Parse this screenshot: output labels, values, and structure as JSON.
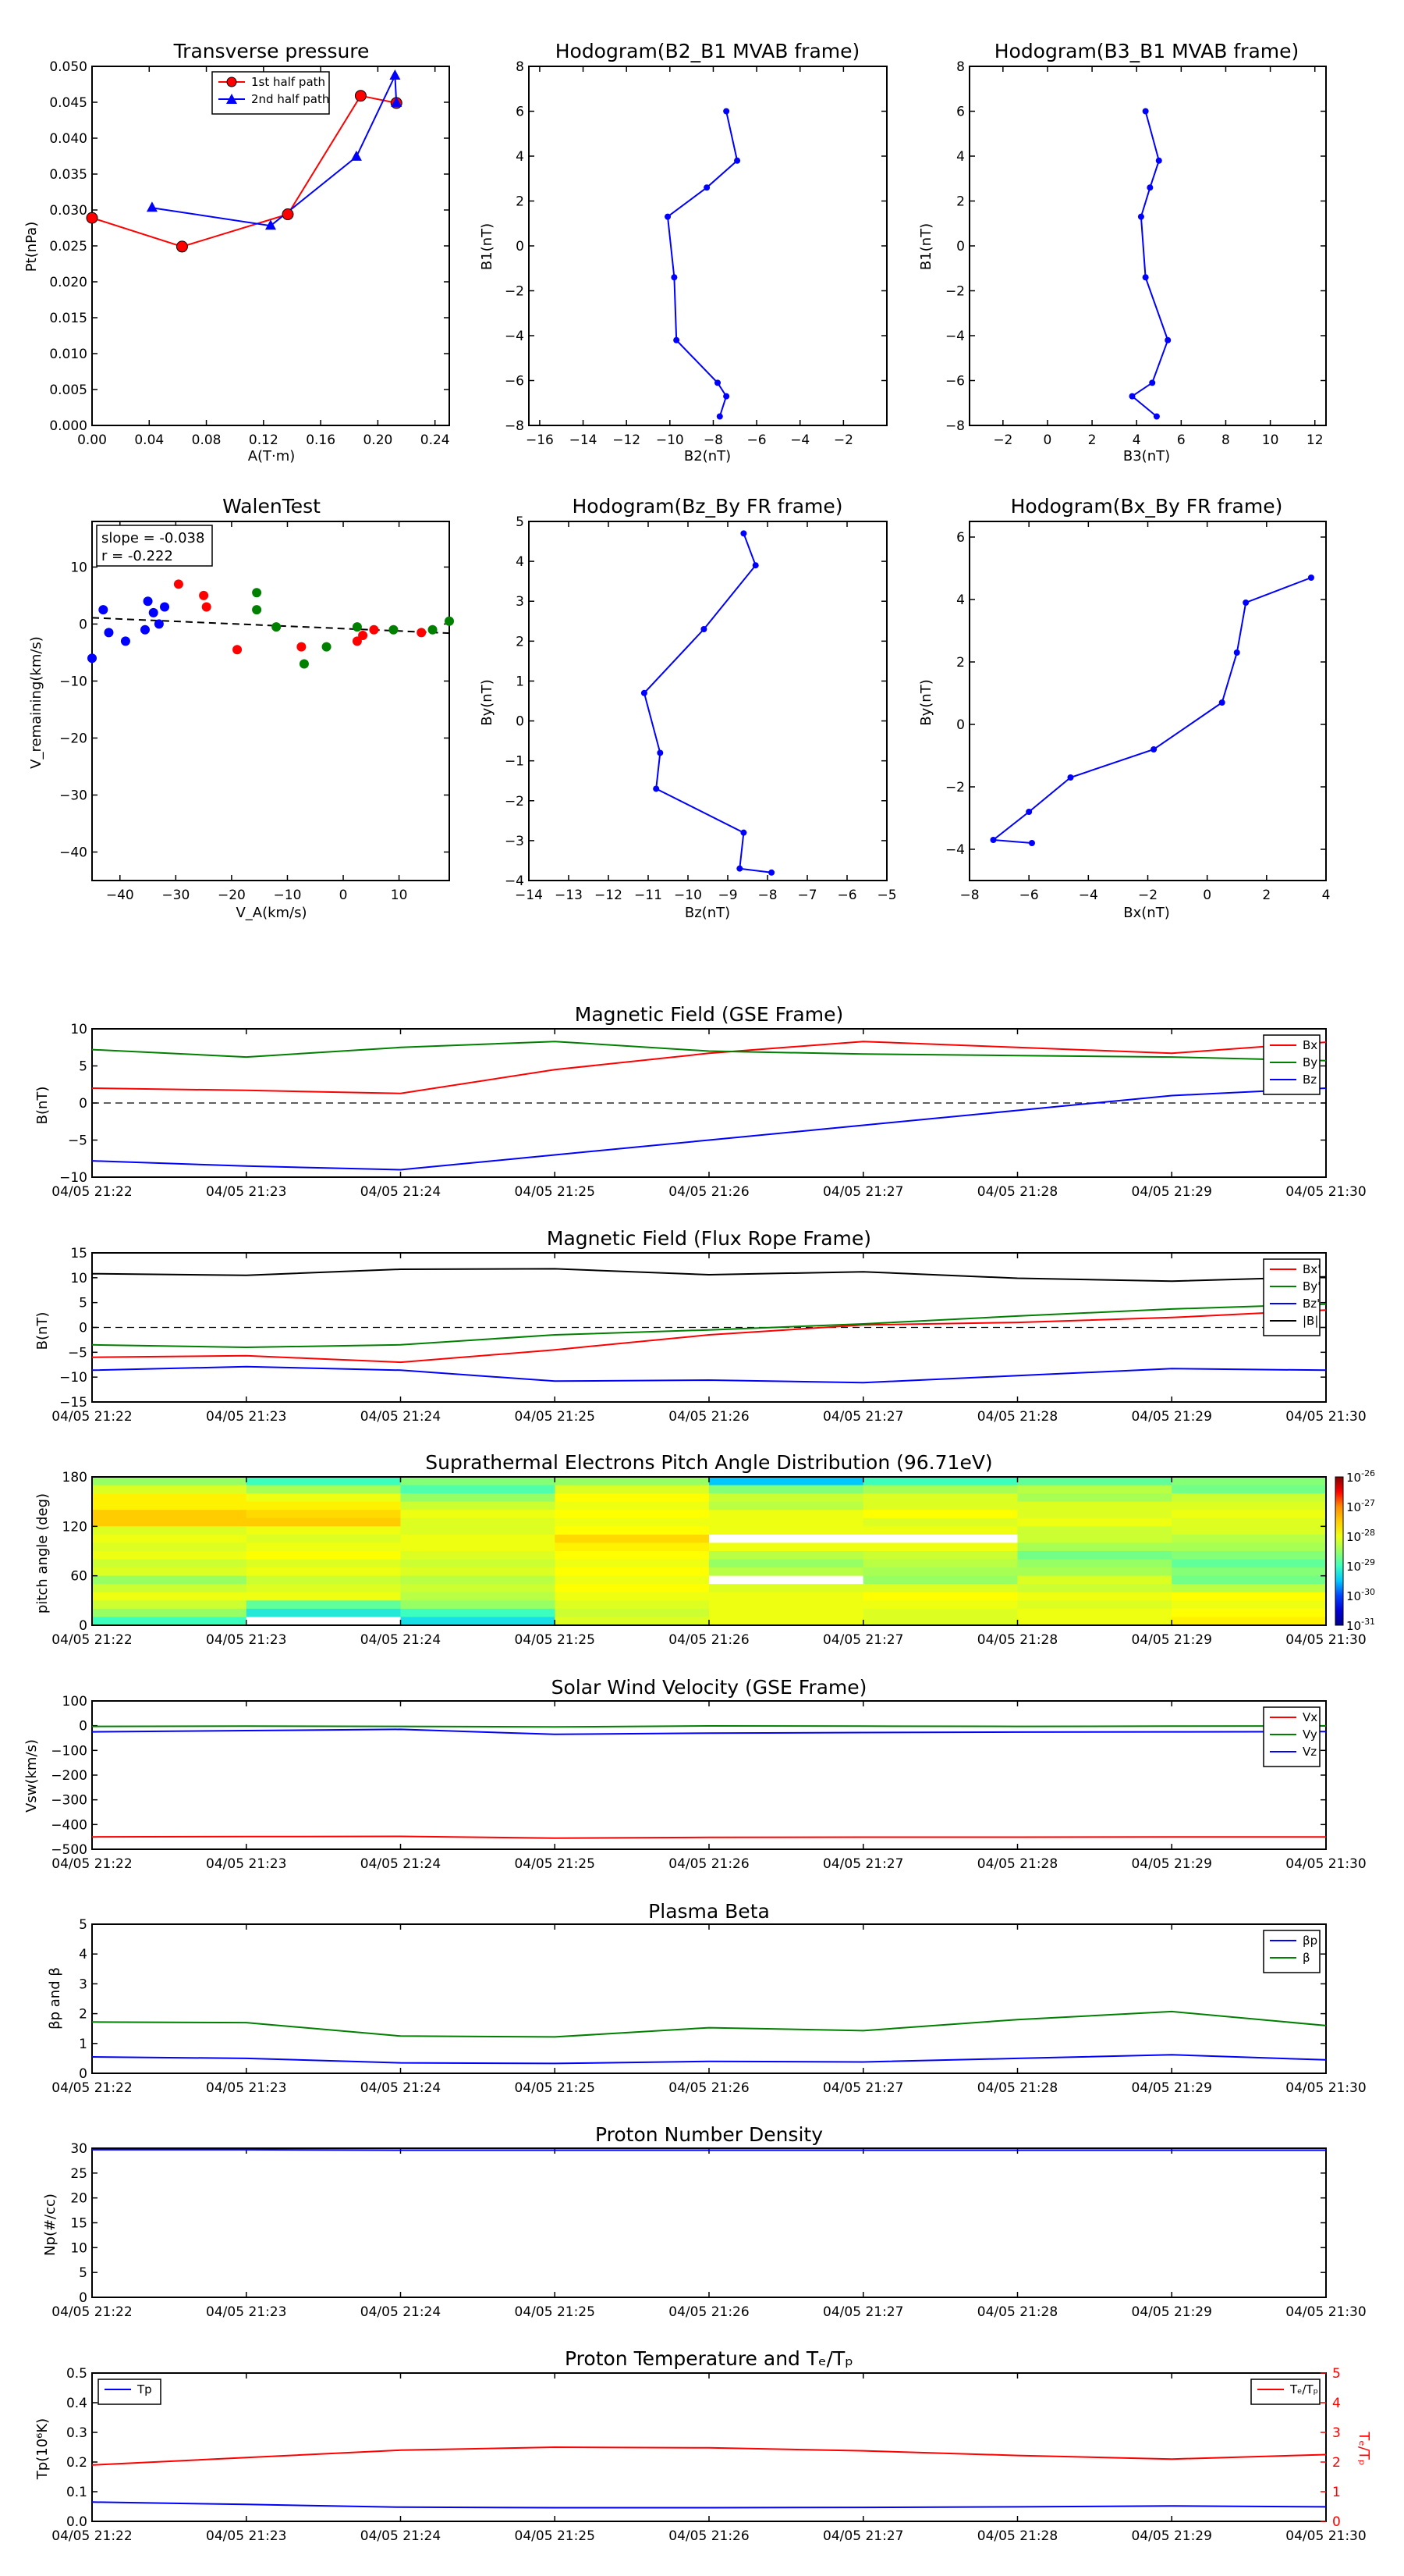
{
  "time_ticks": [
    "04/05 21:22",
    "04/05 21:23",
    "04/05 21:24",
    "04/05 21:25",
    "04/05 21:26",
    "04/05 21:27",
    "04/05 21:28",
    "04/05 21:29",
    "04/05 21:30"
  ],
  "chart_data": [
    {
      "id": "pt",
      "type": "line",
      "title": "Transverse pressure",
      "xlabel": "A(T·m)",
      "ylabel": "Pt(nPa)",
      "xlim": [
        0,
        0.25
      ],
      "ylim": [
        0,
        0.05
      ],
      "xticks": [
        "0.00",
        "0.04",
        "0.08",
        "0.12",
        "0.16",
        "0.20",
        "0.24"
      ],
      "yticks": [
        "0.000",
        "0.005",
        "0.010",
        "0.015",
        "0.020",
        "0.025",
        "0.030",
        "0.035",
        "0.040",
        "0.045",
        "0.050"
      ],
      "legend_position": "top-center",
      "series": [
        {
          "name": "1st half path",
          "color": "#ff0000",
          "marker": "circle",
          "x": [
            0,
            0.063,
            0.137,
            0.188,
            0.213
          ],
          "y": [
            0.0289,
            0.0249,
            0.0294,
            0.0459,
            0.0449
          ]
        },
        {
          "name": "2nd half path",
          "color": "#0000ff",
          "marker": "triangle",
          "x": [
            0.213,
            0.212,
            0.185,
            0.125,
            0.042
          ],
          "y": [
            0.0449,
            0.0487,
            0.0374,
            0.0278,
            0.0303
          ]
        }
      ]
    },
    {
      "id": "h21",
      "type": "line",
      "title": "Hodogram(B2_B1 MVAB frame)",
      "xlabel": "B2(nT)",
      "ylabel": "B1(nT)",
      "xlim": [
        -16.5,
        0
      ],
      "ylim": [
        -8,
        8
      ],
      "xticks": [
        "−16",
        "−14",
        "−12",
        "−10",
        "−8",
        "−6",
        "−4",
        "−2"
      ],
      "yticks": [
        "−8",
        "−6",
        "−4",
        "−2",
        "0",
        "2",
        "4",
        "6",
        "8"
      ],
      "series": [
        {
          "color": "#0000ff",
          "x": [
            -7.4,
            -6.9,
            -8.3,
            -10.1,
            -9.8,
            -9.7,
            -7.8,
            -7.4,
            -7.7
          ],
          "y": [
            6.0,
            3.8,
            2.6,
            1.3,
            -1.4,
            -4.2,
            -6.1,
            -6.7,
            -7.6
          ]
        }
      ]
    },
    {
      "id": "h31",
      "type": "line",
      "title": "Hodogram(B3_B1 MVAB frame)",
      "xlabel": "B3(nT)",
      "ylabel": "B1(nT)",
      "xlim": [
        -3.5,
        12.5
      ],
      "ylim": [
        -8,
        8
      ],
      "xticks": [
        "−2",
        "0",
        "2",
        "4",
        "6",
        "8",
        "10",
        "12"
      ],
      "yticks": [
        "−8",
        "−6",
        "−4",
        "−2",
        "0",
        "2",
        "4",
        "6",
        "8"
      ],
      "series": [
        {
          "color": "#0000ff",
          "x": [
            4.4,
            5.0,
            4.6,
            4.2,
            4.4,
            5.4,
            4.7,
            3.8,
            4.9
          ],
          "y": [
            6.0,
            3.8,
            2.6,
            1.3,
            -1.4,
            -4.2,
            -6.1,
            -6.7,
            -7.6
          ]
        }
      ]
    },
    {
      "id": "walen",
      "type": "scatter",
      "title": "WalenTest",
      "xlabel": "V_A(km/s)",
      "ylabel": "V_remaining(km/s)",
      "xlim": [
        -45,
        19
      ],
      "ylim": [
        -45,
        18
      ],
      "xticks": [
        "−40",
        "−30",
        "−20",
        "−10",
        "0",
        "10"
      ],
      "yticks": [
        "−40",
        "−30",
        "−20",
        "−10",
        "0",
        "10"
      ],
      "annotation": [
        "slope = -0.038",
        "r = -0.222"
      ],
      "fit": {
        "slope": -0.038,
        "x": [
          -45,
          19
        ],
        "y": [
          1.1,
          -1.6
        ]
      },
      "series": [
        {
          "color": "#0000ff",
          "x": [
            -45,
            -43,
            -42,
            -39,
            -35.5,
            -35,
            -34,
            -33,
            -32
          ],
          "y": [
            -6,
            2.5,
            -1.5,
            -3,
            -1,
            4,
            2,
            0,
            3
          ]
        },
        {
          "color": "#ff0000",
          "x": [
            -29.5,
            -25,
            -24.5,
            -19,
            -7.5,
            2.5,
            3.5,
            5.5,
            14
          ],
          "y": [
            7,
            5,
            3,
            -4.5,
            -4,
            -3,
            -2,
            -1,
            -1.5
          ]
        },
        {
          "color": "#008000",
          "x": [
            -15.5,
            -15.5,
            -12,
            -7,
            -3,
            2.5,
            9,
            16,
            19
          ],
          "y": [
            5.5,
            2.5,
            -0.5,
            -7,
            -4,
            -0.5,
            -1,
            -1,
            0.5
          ]
        }
      ]
    },
    {
      "id": "hzy",
      "type": "line",
      "title": "Hodogram(Bz_By FR frame)",
      "xlabel": "Bz(nT)",
      "ylabel": "By(nT)",
      "xlim": [
        -14,
        -5
      ],
      "ylim": [
        -4,
        5
      ],
      "xticks": [
        "−14",
        "−13",
        "−12",
        "−11",
        "−10",
        "−9",
        "−8",
        "−7",
        "−6",
        "−5"
      ],
      "yticks": [
        "−4",
        "−3",
        "−2",
        "−1",
        "0",
        "1",
        "2",
        "3",
        "4",
        "5"
      ],
      "series": [
        {
          "color": "#0000ff",
          "x": [
            -8.6,
            -8.3,
            -9.6,
            -11.1,
            -10.7,
            -10.8,
            -8.6,
            -8.7,
            -7.9
          ],
          "y": [
            4.7,
            3.9,
            2.3,
            0.7,
            -0.8,
            -1.7,
            -2.8,
            -3.7,
            -3.8
          ]
        }
      ]
    },
    {
      "id": "hxy",
      "type": "line",
      "title": "Hodogram(Bx_By FR frame)",
      "xlabel": "Bx(nT)",
      "ylabel": "By(nT)",
      "xlim": [
        -8,
        4
      ],
      "ylim": [
        -5,
        6.5
      ],
      "xticks": [
        "−8",
        "−6",
        "−4",
        "−2",
        "0",
        "2",
        "4"
      ],
      "yticks": [
        "−4",
        "−2",
        "0",
        "2",
        "4",
        "6"
      ],
      "series": [
        {
          "color": "#0000ff",
          "x": [
            3.5,
            1.3,
            1.0,
            0.5,
            -1.8,
            -4.6,
            -6.0,
            -7.2,
            -5.9
          ],
          "y": [
            4.7,
            3.9,
            2.3,
            0.7,
            -0.8,
            -1.7,
            -2.8,
            -3.7,
            -3.8
          ]
        }
      ]
    },
    {
      "id": "bgse",
      "type": "line",
      "title": "Magnetic Field (GSE Frame)",
      "ylabel": "B(nT)",
      "ylim": [
        -10,
        10
      ],
      "yticks": [
        "−10",
        "−5",
        "0",
        "5",
        "10"
      ],
      "legend_position": "top-right",
      "x": [
        0,
        1,
        2,
        3,
        4,
        5,
        6,
        7,
        8
      ],
      "series": [
        {
          "name": "Bx",
          "color": "#ff0000",
          "values": [
            2.0,
            1.7,
            1.3,
            4.5,
            6.7,
            8.3,
            7.5,
            6.7,
            8.2
          ]
        },
        {
          "name": "By",
          "color": "#008000",
          "values": [
            7.2,
            6.2,
            7.5,
            8.3,
            7.0,
            6.6,
            6.4,
            6.2,
            5.7
          ]
        },
        {
          "name": "Bz",
          "color": "#0000ff",
          "values": [
            -7.8,
            -8.5,
            -9.0,
            -7.0,
            -5.0,
            -3.0,
            -1.0,
            1.0,
            2.0
          ]
        }
      ],
      "zero_line": true
    },
    {
      "id": "bfr",
      "type": "line",
      "title": "Magnetic Field (Flux Rope Frame)",
      "ylabel": "B(nT)",
      "ylim": [
        -15,
        15
      ],
      "yticks": [
        "−15",
        "−10",
        "−5",
        "0",
        "5",
        "10",
        "15"
      ],
      "legend_position": "top-right",
      "x": [
        0,
        1,
        2,
        3,
        4,
        5,
        6,
        7,
        8
      ],
      "series": [
        {
          "name": "Bx'",
          "color": "#ff0000",
          "values": [
            -6,
            -5.7,
            -7,
            -4.5,
            -1.5,
            0.5,
            1.0,
            2.0,
            3.5
          ]
        },
        {
          "name": "By'",
          "color": "#008000",
          "values": [
            -3.5,
            -4,
            -3.5,
            -1.5,
            -0.5,
            0.7,
            2.3,
            3.7,
            4.7
          ]
        },
        {
          "name": "Bz'",
          "color": "#0000ff",
          "values": [
            -8.6,
            -7.9,
            -8.6,
            -10.8,
            -10.6,
            -11.1,
            -9.7,
            -8.3,
            -8.6
          ]
        },
        {
          "name": "|B|",
          "color": "#000000",
          "values": [
            10.8,
            10.5,
            11.7,
            11.8,
            10.6,
            11.2,
            9.9,
            9.3,
            10.2
          ]
        }
      ],
      "zero_line": true
    },
    {
      "id": "pad",
      "type": "heatmap",
      "title": "Suprathermal Electrons Pitch Angle Distribution (96.71eV)",
      "ylabel": "pitch angle (deg)",
      "ylim": [
        0,
        180
      ],
      "yticks": [
        "0",
        "60",
        "120",
        "180"
      ],
      "colorbar_ticks": [
        "10^-31",
        "10^-30",
        "10^-29",
        "10^-28",
        "10^-27",
        "10^-26"
      ],
      "n_angle_bins": 18,
      "values_log10": [
        [
          -28.5,
          -29.0,
          -28.6,
          -28.5,
          -29.5,
          -29.0,
          -28.8,
          -28.6
        ],
        [
          -28.1,
          -28.4,
          -28.9,
          -28.1,
          -28.6,
          -28.4,
          -28.3,
          -28.7
        ],
        [
          -27.8,
          -28.0,
          -28.5,
          -27.9,
          -28.2,
          -28.1,
          -28.4,
          -28.2
        ],
        [
          -27.8,
          -27.8,
          -28.2,
          -28.0,
          -28.3,
          -28.1,
          -28.1,
          -28.1
        ],
        [
          -27.5,
          -27.6,
          -28.0,
          -27.9,
          -28.0,
          -27.9,
          -28.1,
          -28.0
        ],
        [
          -27.5,
          -27.5,
          -28.1,
          -28.0,
          -28.0,
          -28.1,
          -28.0,
          -28.1
        ],
        [
          -28.1,
          -28.0,
          -28.1,
          -27.9,
          -28.0,
          -28.0,
          -28.2,
          -28.1
        ],
        [
          -28.0,
          -28.1,
          -28.0,
          -27.6,
          -31.5,
          -31.5,
          -28.2,
          -28.3
        ],
        [
          -28.1,
          -28.0,
          -28.0,
          -27.8,
          -28.0,
          -28.0,
          -28.4,
          -28.4
        ],
        [
          -28.0,
          -27.9,
          -28.1,
          -27.9,
          -28.3,
          -28.2,
          -28.7,
          -28.6
        ],
        [
          -28.2,
          -28.1,
          -28.2,
          -28.0,
          -28.5,
          -28.3,
          -28.5,
          -28.8
        ],
        [
          -28.1,
          -28.0,
          -28.1,
          -27.9,
          -28.3,
          -28.4,
          -28.4,
          -28.6
        ],
        [
          -28.5,
          -28.2,
          -28.3,
          -28.0,
          -31.5,
          -28.5,
          -28.1,
          -28.7
        ],
        [
          -28.2,
          -28.1,
          -28.2,
          -27.9,
          -28.1,
          -28.1,
          -28.2,
          -28.3
        ],
        [
          -28.0,
          -28.0,
          -28.3,
          -28.0,
          -28.0,
          -27.9,
          -28.0,
          -27.9
        ],
        [
          -28.2,
          -28.8,
          -28.5,
          -28.1,
          -28.0,
          -28.0,
          -28.1,
          -28.0
        ],
        [
          -28.5,
          -29.2,
          -29.0,
          -28.2,
          -28.0,
          -28.1,
          -28.0,
          -27.9
        ],
        [
          -29.0,
          -31.5,
          -29.3,
          -28.1,
          -28.0,
          -28.1,
          -28.0,
          -27.8
        ]
      ]
    },
    {
      "id": "vsw",
      "type": "line",
      "title": "Solar Wind Velocity (GSE Frame)",
      "ylabel": "Vsw(km/s)",
      "ylim": [
        -500,
        100
      ],
      "yticks": [
        "−500",
        "−400",
        "−300",
        "−200",
        "−100",
        "0",
        "100"
      ],
      "legend_position": "top-right",
      "x": [
        0,
        1,
        2,
        3,
        4,
        5,
        6,
        7,
        8
      ],
      "series": [
        {
          "name": "Vx",
          "color": "#ff0000",
          "values": [
            -450,
            -449,
            -448,
            -455,
            -452,
            -451,
            -451,
            -450,
            -450
          ]
        },
        {
          "name": "Vy",
          "color": "#008000",
          "values": [
            -3,
            -2,
            -3,
            -5,
            -1,
            -2,
            -3,
            -2,
            -1
          ]
        },
        {
          "name": "Vz",
          "color": "#0000ff",
          "values": [
            -25,
            -20,
            -15,
            -35,
            -30,
            -28,
            -26,
            -25,
            -24
          ]
        }
      ]
    },
    {
      "id": "beta",
      "type": "line",
      "title": "Plasma Beta",
      "ylabel": "βp and β",
      "ylim": [
        0,
        5
      ],
      "yticks": [
        "0",
        "1",
        "2",
        "3",
        "4",
        "5"
      ],
      "legend_position": "top-right",
      "x": [
        0,
        1,
        2,
        3,
        4,
        5,
        6,
        7,
        8
      ],
      "series": [
        {
          "name": "βp",
          "color": "#0000ff",
          "values": [
            0.55,
            0.5,
            0.35,
            0.33,
            0.4,
            0.38,
            0.5,
            0.62,
            0.45
          ]
        },
        {
          "name": "β",
          "color": "#008000",
          "values": [
            1.72,
            1.7,
            1.25,
            1.22,
            1.53,
            1.43,
            1.8,
            2.07,
            1.6
          ]
        }
      ]
    },
    {
      "id": "np",
      "type": "line",
      "title": "Proton Number Density",
      "ylabel": "Np(#/cc)",
      "ylim": [
        0,
        30
      ],
      "yticks": [
        "0",
        "5",
        "10",
        "15",
        "20",
        "25",
        "30"
      ],
      "x": [
        0,
        1,
        2,
        3,
        4,
        5,
        6,
        7,
        8
      ],
      "series": [
        {
          "color": "#0000ff",
          "values": [
            29.7,
            29.7,
            29.6,
            29.6,
            29.6,
            29.6,
            29.6,
            29.6,
            29.6
          ]
        }
      ]
    },
    {
      "id": "tp",
      "type": "line",
      "title": "Proton Temperature and Tₑ/Tₚ",
      "ylabel": "Tp(10⁶K)",
      "ylim": [
        0,
        0.5
      ],
      "yticks": [
        "0.0",
        "0.1",
        "0.2",
        "0.3",
        "0.4",
        "0.5"
      ],
      "y2label": "Tₑ/Tₚ",
      "y2lim": [
        0,
        5
      ],
      "y2ticks": [
        "0",
        "1",
        "2",
        "3",
        "4",
        "5"
      ],
      "x": [
        0,
        1,
        2,
        3,
        4,
        5,
        6,
        7,
        8
      ],
      "series": [
        {
          "name": "Tp",
          "color": "#0000ff",
          "axis": "left",
          "values": [
            0.065,
            0.057,
            0.048,
            0.046,
            0.046,
            0.047,
            0.049,
            0.052,
            0.049
          ]
        },
        {
          "name": "Tₑ/Tₚ",
          "color": "#ff0000",
          "axis": "right",
          "values": [
            1.9,
            2.15,
            2.4,
            2.5,
            2.48,
            2.38,
            2.22,
            2.1,
            2.25
          ]
        }
      ]
    }
  ]
}
